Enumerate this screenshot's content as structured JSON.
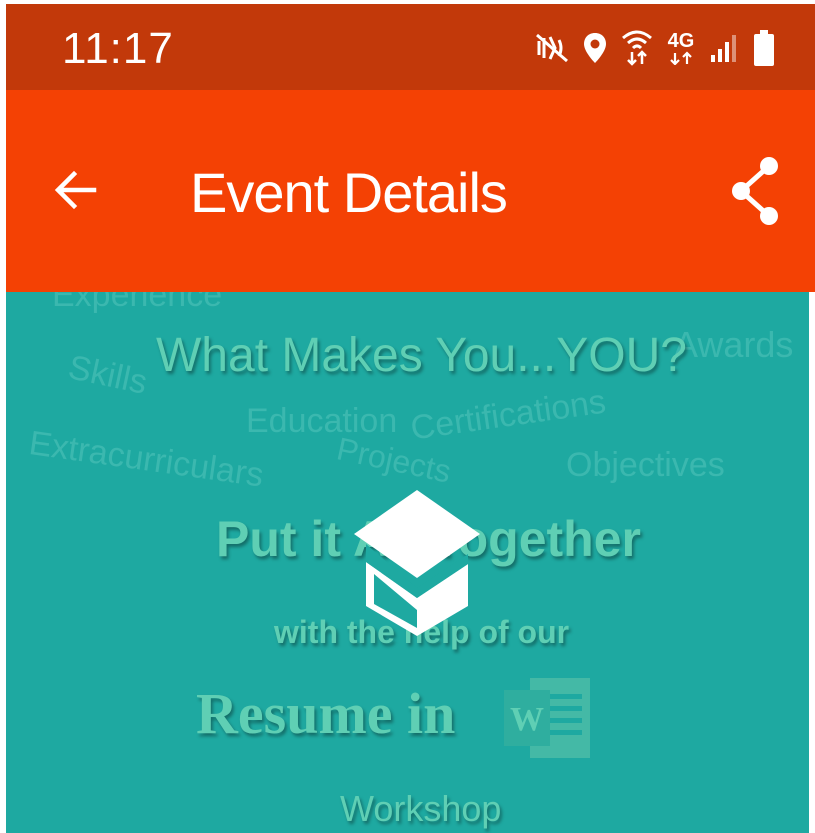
{
  "status_bar": {
    "time": "11:17",
    "network": "4G",
    "icons": [
      "mute-vibrate-icon",
      "location-icon",
      "wifi-calling-icon",
      "network-4g-icon",
      "signal-icon",
      "battery-icon"
    ]
  },
  "app_bar": {
    "title": "Event Details",
    "back_icon": "arrow-left-icon",
    "share_icon": "share-icon",
    "color": "#f44104"
  },
  "banner": {
    "background": "#1ea9a1",
    "background_words": [
      "Experience",
      "Skills",
      "Awards",
      "Education",
      "Certifications",
      "Extracurriculars",
      "Projects",
      "Objectives"
    ],
    "headline": "What Makes You...YOU?",
    "line2": "Put it All Together",
    "line3": "with the help of our",
    "line4": "Resume in",
    "line5": "Workshop",
    "word_logo_letter": "W",
    "center_logo": "graduation-cap-icon"
  }
}
